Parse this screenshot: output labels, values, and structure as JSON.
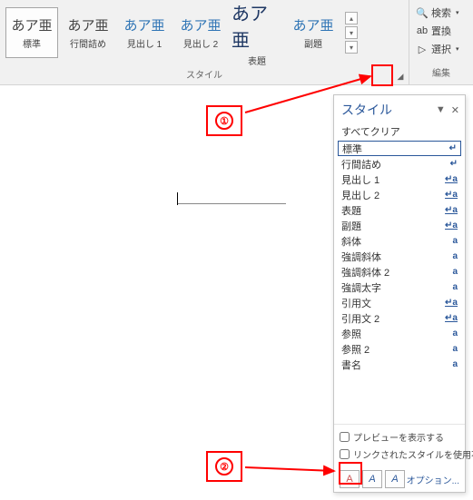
{
  "ribbon": {
    "styles_label": "スタイル",
    "gallery": [
      {
        "preview": "あア亜",
        "label": "標準",
        "cls": "",
        "selected": true
      },
      {
        "preview": "あア亜",
        "label": "行間詰め",
        "cls": ""
      },
      {
        "preview": "あア亜",
        "label": "見出し 1",
        "cls": "accent"
      },
      {
        "preview": "あア亜",
        "label": "見出し 2",
        "cls": "accent"
      },
      {
        "preview": "あア亜",
        "label": "表題",
        "cls": "big"
      },
      {
        "preview": "あア亜",
        "label": "副題",
        "cls": "accent"
      }
    ],
    "edit_group_label": "編集",
    "edit_items": [
      {
        "icon": "🔍",
        "label": "検索"
      },
      {
        "icon": "ab",
        "label": "置換"
      },
      {
        "icon": "▷",
        "label": "選択"
      }
    ]
  },
  "pane": {
    "title": "スタイル",
    "clear_all": "すべてクリア",
    "styles": [
      {
        "name": "標準",
        "mark": "↵",
        "markcls": "para",
        "sel": true
      },
      {
        "name": "行間詰め",
        "mark": "↵",
        "markcls": "para"
      },
      {
        "name": "見出し 1",
        "mark": "↵a",
        "markcls": "linked"
      },
      {
        "name": "見出し 2",
        "mark": "↵a",
        "markcls": "linked"
      },
      {
        "name": "表題",
        "mark": "↵a",
        "markcls": "linked"
      },
      {
        "name": "副題",
        "mark": "↵a",
        "markcls": "linked"
      },
      {
        "name": "斜体",
        "mark": "a",
        "markcls": "char"
      },
      {
        "name": "強調斜体",
        "mark": "a",
        "markcls": "char"
      },
      {
        "name": "強調斜体 2",
        "mark": "a",
        "markcls": "char"
      },
      {
        "name": "強調太字",
        "mark": "a",
        "markcls": "char"
      },
      {
        "name": "引用文",
        "mark": "↵a",
        "markcls": "linked"
      },
      {
        "name": "引用文 2",
        "mark": "↵a",
        "markcls": "linked"
      },
      {
        "name": "参照",
        "mark": "a",
        "markcls": "char"
      },
      {
        "name": "参照 2",
        "mark": "a",
        "markcls": "char"
      },
      {
        "name": "書名",
        "mark": "a",
        "markcls": "char"
      }
    ],
    "check_preview": "プレビューを表示する",
    "check_linked": "リンクされたスタイルを使用不可にする",
    "options": "オプション..."
  },
  "annotations": {
    "num1": "①",
    "num2": "②"
  }
}
